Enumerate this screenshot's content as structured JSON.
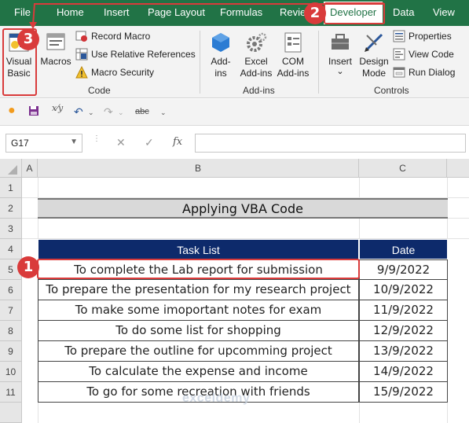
{
  "ribbon_tabs": {
    "file": "File",
    "home": "Home",
    "insert": "Insert",
    "page_layout": "Page Layout",
    "formulas": "Formulas",
    "review": "Review",
    "developer": "Developer",
    "data": "Data",
    "view": "View"
  },
  "code_group": {
    "visual_basic_line1": "Visual",
    "visual_basic_line2": "Basic",
    "macros": "Macros",
    "record_macro": "Record Macro",
    "relative_refs": "Use Relative References",
    "macro_security": "Macro Security",
    "label": "Code"
  },
  "addins_group": {
    "addins_line1": "Add-",
    "addins_line2": "ins",
    "excel_addins_line1": "Excel",
    "excel_addins_line2": "Add-ins",
    "com_addins_line1": "COM",
    "com_addins_line2": "Add-ins",
    "label": "Add-ins"
  },
  "controls_group": {
    "insert": "Insert",
    "insert_caret": "⌄",
    "design_mode_line1": "Design",
    "design_mode_line2": "Mode",
    "properties": "Properties",
    "view_code": "View Code",
    "run_dialog": "Run Dialog",
    "label": "Controls"
  },
  "quick_access": {
    "abc_label": "abc"
  },
  "formula_bar": {
    "name_box": "G17",
    "formula": "",
    "fx_label": "fx"
  },
  "sheet": {
    "columns": [
      "A",
      "B",
      "C"
    ],
    "rows": [
      "1",
      "2",
      "3",
      "4",
      "5",
      "6",
      "7",
      "8",
      "9",
      "10",
      "11"
    ],
    "title": "Applying VBA Code",
    "header_task": "Task List",
    "header_date": "Date",
    "tasks": [
      {
        "task": "To complete the Lab report for submission",
        "date": "9/9/2022"
      },
      {
        "task": "To prepare the presentation for my research project",
        "date": "10/9/2022"
      },
      {
        "task": "To make some imoportant notes for exam",
        "date": "11/9/2022"
      },
      {
        "task": "To do some list for shopping",
        "date": "12/9/2022"
      },
      {
        "task": "To prepare the outline for upcomming project",
        "date": "13/9/2022"
      },
      {
        "task": "To calculate the expense and income",
        "date": "14/9/2022"
      },
      {
        "task": "To go for some recreation with friends",
        "date": "15/9/2022"
      }
    ]
  },
  "callouts": {
    "step1": "1",
    "step2": "2",
    "step3": "3"
  },
  "watermark": "exceldemy",
  "colors": {
    "excel_green": "#217346",
    "header_navy": "#0d2a6b",
    "title_bg": "#d9d9d9",
    "callout_red": "#d93b3b"
  }
}
